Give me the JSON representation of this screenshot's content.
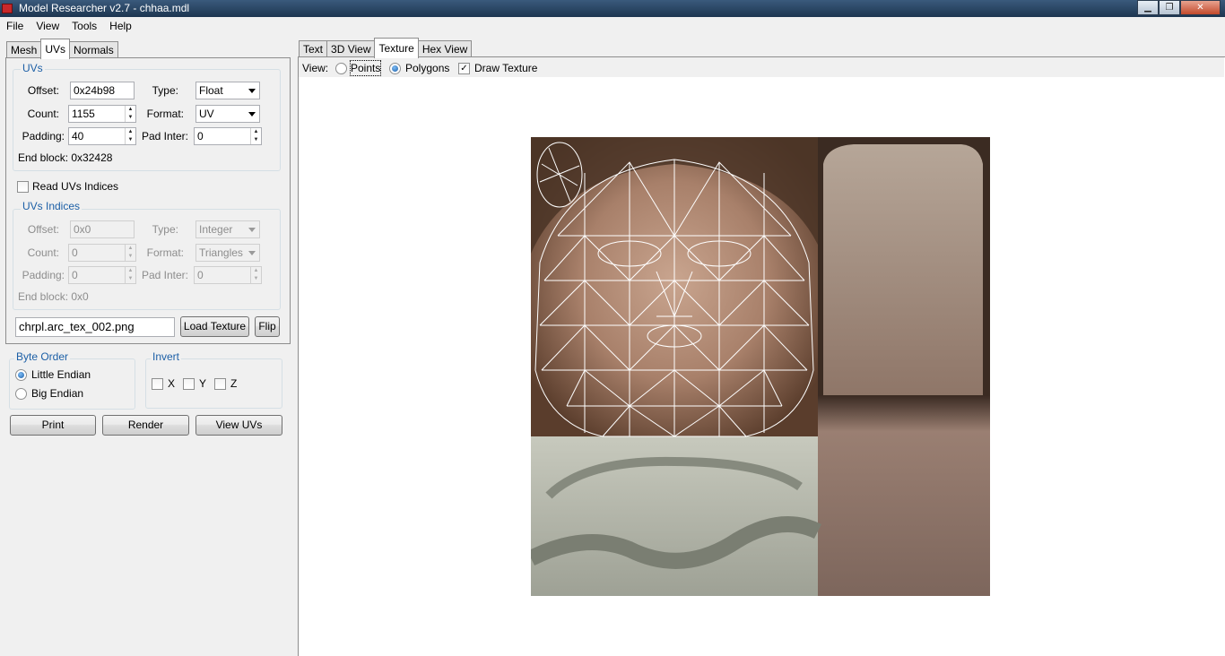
{
  "window": {
    "title": "Model Researcher v2.7 - chhaa.mdl",
    "minimize_glyph": "▁",
    "maximize_glyph": "❐",
    "close_glyph": "✕"
  },
  "menu": [
    "File",
    "View",
    "Tools",
    "Help"
  ],
  "left_tabs": [
    "Mesh",
    "UVs",
    "Normals"
  ],
  "uvs": {
    "legend": "UVs",
    "offset_label": "Offset:",
    "offset_value": "0x24b98",
    "type_label": "Type:",
    "type_value": "Float",
    "count_label": "Count:",
    "count_value": "1155",
    "format_label": "Format:",
    "format_value": "UV",
    "padding_label": "Padding:",
    "padding_value": "40",
    "padinter_label": "Pad Inter:",
    "padinter_value": "0",
    "end_block": "End block: 0x32428"
  },
  "read_indices": {
    "label": "Read UVs Indices",
    "checked": false
  },
  "uv_indices": {
    "legend": "UVs Indices",
    "offset_label": "Offset:",
    "offset_value": "0x0",
    "type_label": "Type:",
    "type_value": "Integer",
    "count_label": "Count:",
    "count_value": "0",
    "format_label": "Format:",
    "format_value": "Triangles",
    "padding_label": "Padding:",
    "padding_value": "0",
    "padinter_label": "Pad Inter:",
    "padinter_value": "0",
    "end_block": "End block: 0x0"
  },
  "texture": {
    "file": "chrpl.arc_tex_002.png",
    "load_label": "Load Texture",
    "flip_label": "Flip"
  },
  "byte_order": {
    "legend": "Byte Order",
    "little": "Little Endian",
    "big": "Big Endian",
    "selected": "Little Endian"
  },
  "invert": {
    "legend": "Invert",
    "x": "X",
    "y": "Y",
    "z": "Z"
  },
  "actions": {
    "print": "Print",
    "render": "Render",
    "view_uvs": "View UVs"
  },
  "right_tabs": [
    "Text",
    "3D View",
    "Texture",
    "Hex View"
  ],
  "view_bar": {
    "label": "View:",
    "points": "Points",
    "polygons": "Polygons",
    "draw_texture": "Draw Texture",
    "draw_texture_checked": true,
    "mode": "Polygons"
  },
  "colors": {
    "accent": "#1c5fa6",
    "wireframe": "#ffffff",
    "titlebar": "#1d3550"
  }
}
